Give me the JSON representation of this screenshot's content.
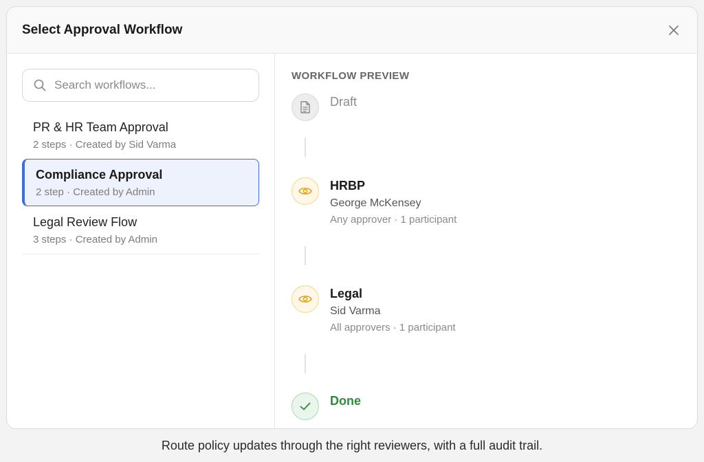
{
  "modal": {
    "title": "Select Approval Workflow",
    "close_icon": "close-icon"
  },
  "search": {
    "placeholder": "Search workflows...",
    "value": "",
    "icon": "search-icon"
  },
  "workflows": [
    {
      "name": "PR & HR Team Approval",
      "meta": "2 steps · Created by Sid Varma",
      "selected": false
    },
    {
      "name": "Compliance Approval",
      "meta": "2 step · Created by Admin",
      "selected": true
    },
    {
      "name": "Legal Review Flow",
      "meta": "3 steps · Created by Admin",
      "selected": false
    }
  ],
  "preview": {
    "heading": "WORKFLOW PREVIEW",
    "steps": [
      {
        "title": "Draft",
        "icon": "document-icon"
      },
      {
        "title": "HRBP",
        "person": "George McKensey",
        "detail": "Any approver · 1 participant",
        "icon": "eye-icon"
      },
      {
        "title": "Legal",
        "person": "Sid Varma",
        "detail": "All approvers · 1 participant",
        "icon": "eye-icon"
      },
      {
        "title": "Done",
        "icon": "check-icon"
      }
    ]
  },
  "colors": {
    "accent": "#3b6fe0",
    "review": "#e3a21a",
    "done": "#2e8b3a"
  },
  "caption": "Route policy updates through the right reviewers, with a full audit trail."
}
